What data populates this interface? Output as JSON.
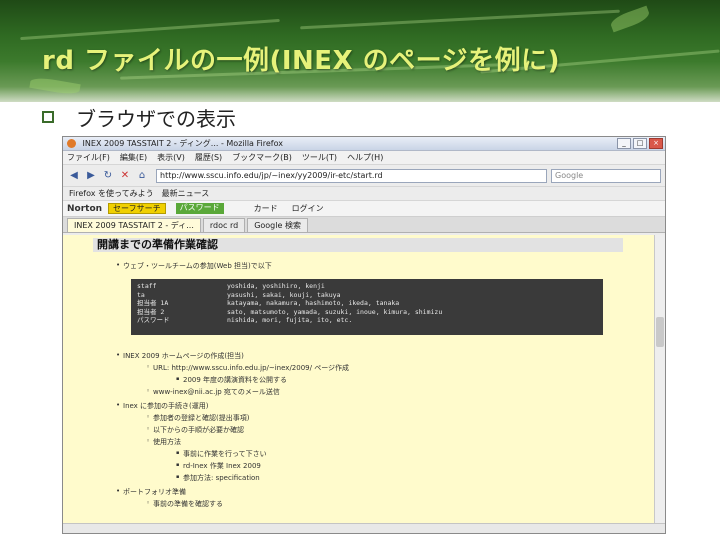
{
  "slide": {
    "title": "rd ファイルの一例(INEX のページを例に)",
    "bullet": "ブラウザでの表示"
  },
  "browser": {
    "window_title": "INEX 2009 TASSTAIT 2 - ディング... - Mozilla Firefox",
    "menu": [
      "ファイル(F)",
      "編集(E)",
      "表示(V)",
      "履歴(S)",
      "ブックマーク(B)",
      "ツール(T)",
      "ヘルプ(H)"
    ],
    "url": "http://www.sscu.info.edu/jp/~inex/yy2009/ir-etc/start.rd",
    "search_placeholder": "Google",
    "bookmarks": [
      "Firefox を使ってみよう",
      "最新ニュース"
    ],
    "norton": {
      "logo": "Norton",
      "safe_label": "セーフサーチ",
      "password_label": "パスワード",
      "items": [
        "カード",
        "ログイン"
      ]
    },
    "tabs": [
      "INEX 2009 TASSTAIT 2 - ディ...",
      "rdoc rd",
      "Google 検索"
    ],
    "page": {
      "heading": "開講までの準備作業確認",
      "items": [
        {
          "level": 1,
          "text": "ウェブ・ツールチームの参加(Web 担当)で以下"
        },
        {
          "level": 1,
          "text": "INEX 2009 ホームページの作成(担当)"
        },
        {
          "level": 2,
          "text": "URL: http://www.sscu.info.edu.jp/~inex/2009/ ページ作成"
        },
        {
          "level": 3,
          "text": "2009 年度の講演資料を公開する"
        },
        {
          "level": 2,
          "text": "www-inex@nii.ac.jp 宛てのメール送信"
        },
        {
          "level": 1,
          "text": "Inex に参加の手続き(運用)"
        },
        {
          "level": 2,
          "text": "参加者の登録と確認(提出事項)"
        },
        {
          "level": 2,
          "text": "以下からの手順が必要か確認"
        },
        {
          "level": 2,
          "text": "使用方法"
        },
        {
          "level": 3,
          "text": "事前に作業を行って下さい"
        },
        {
          "level": 3,
          "text": "rd-Inex 作業 Inex 2009"
        },
        {
          "level": 3,
          "text": "参加方法: specification"
        },
        {
          "level": 1,
          "text": "ポートフォリオ準備"
        },
        {
          "level": 2,
          "text": "事前の準備を確認する"
        }
      ],
      "code_rows": [
        {
          "key": "staff",
          "val": "yoshida, yoshihiro, kenji"
        },
        {
          "key": "ta",
          "val": "yasushi, sakai, kouji, takuya"
        },
        {
          "key": "担当者 1A",
          "val": "katayama, nakamura, hashimoto, ikeda, tanaka"
        },
        {
          "key": "担当者 2",
          "val": "sato, matsumoto, yamada, suzuki, inoue, kimura, shimizu"
        },
        {
          "key": "パスワード",
          "val": "nishida, mori, fujita, ito, etc."
        }
      ]
    }
  }
}
